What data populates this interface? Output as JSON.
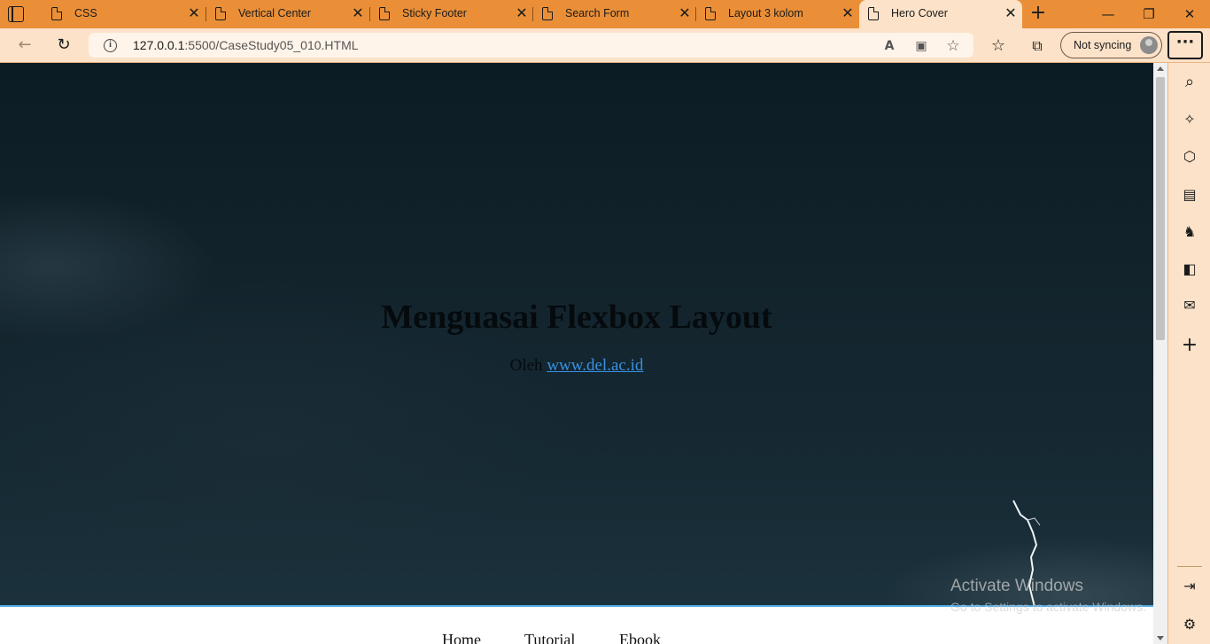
{
  "browser": {
    "tabs": [
      {
        "title": "CSS"
      },
      {
        "title": "Vertical Center"
      },
      {
        "title": "Sticky Footer"
      },
      {
        "title": "Search Form"
      },
      {
        "title": "Layout 3 kolom"
      },
      {
        "title": "Hero Cover",
        "active": true
      }
    ],
    "tab_close_glyph": "✕",
    "new_tab_glyph": "+",
    "address": {
      "host": "127.0.0.1",
      "rest": ":5500/CaseStudy05_010.HTML"
    },
    "profile_label": "Not syncing",
    "more_glyph": "···",
    "theme_color": "#ea8f37",
    "toolbar_color": "#fbe2c8"
  },
  "page": {
    "hero": {
      "title": "Menguasai Flexbox Layout",
      "byline_prefix": "Oleh",
      "byline_link": "www.del.ac.id"
    },
    "nav": [
      "Home",
      "Tutorial",
      "Ebook"
    ],
    "accent_color": "#4aa3dc"
  },
  "watermark": {
    "line1": "Activate Windows",
    "line2": "Go to Settings to activate Windows."
  },
  "icons": {
    "back": "←",
    "refresh": "↻",
    "read_aloud": "A",
    "immersive": "▣",
    "add_favorite": "☆",
    "favorites": "☆",
    "collections": "⧉",
    "search": "⌕",
    "copilot": "✧",
    "shopping": "⬡",
    "tools": "▤",
    "games": "♞",
    "office": "◧",
    "outlook": "✉",
    "add": "+",
    "split": "⇥",
    "settings": "⚙",
    "minimize": "—",
    "restore": "❐",
    "close": "✕"
  }
}
